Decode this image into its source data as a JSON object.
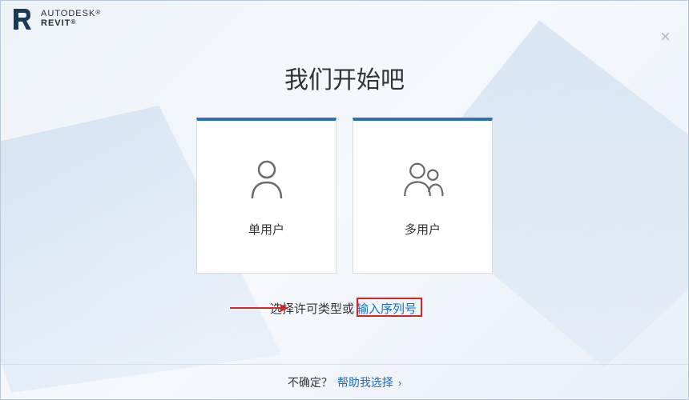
{
  "brand": {
    "company": "AUTODESK",
    "product": "REVIT"
  },
  "title": "我们开始吧",
  "cards": {
    "single": {
      "label": "单用户"
    },
    "multi": {
      "label": "多用户"
    }
  },
  "prompt": {
    "prefix": "选择许可类型或 ",
    "link": "输入序列号"
  },
  "footer": {
    "question": "不确定？",
    "help_link": "帮助我选择"
  }
}
